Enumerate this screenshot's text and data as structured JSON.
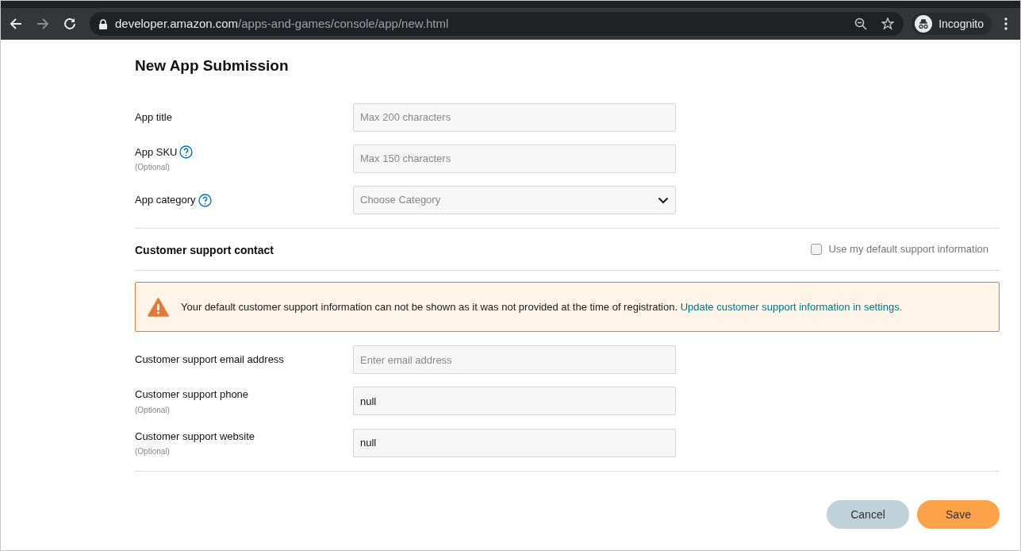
{
  "browser": {
    "url_host": "developer.amazon.com",
    "url_path": "/apps-and-games/console/app/new.html",
    "profile": "Incognito"
  },
  "page": {
    "title": "New App Submission"
  },
  "app_fields": [
    {
      "kind": "text",
      "label": "App title",
      "placeholder": "Max 200 characters",
      "help": false
    },
    {
      "kind": "text",
      "label": "App SKU",
      "note": "(Optional)",
      "placeholder": "Max 150 characters",
      "help": true
    },
    {
      "kind": "select",
      "label": "App category",
      "placeholder": "Choose Category",
      "help": true
    }
  ],
  "support": {
    "heading": "Customer support contact",
    "default_checkbox": {
      "label": "Use my default support information",
      "checked": false
    },
    "warning": {
      "text": "Your default customer support information can not be shown as it was not provided at the time of registration.",
      "link": "Update customer support information in settings."
    },
    "fields": [
      {
        "kind": "text",
        "label": "Customer support email address",
        "placeholder": "Enter email address"
      },
      {
        "kind": "text",
        "label": "Customer support phone",
        "note": "(Optional)",
        "value": "null"
      },
      {
        "kind": "text",
        "label": "Customer support website",
        "note": "(Optional)",
        "value": "null"
      }
    ]
  },
  "buttons": [
    {
      "kind": "secondary",
      "label": "Cancel"
    },
    {
      "kind": "primary",
      "label": "Save"
    }
  ]
}
